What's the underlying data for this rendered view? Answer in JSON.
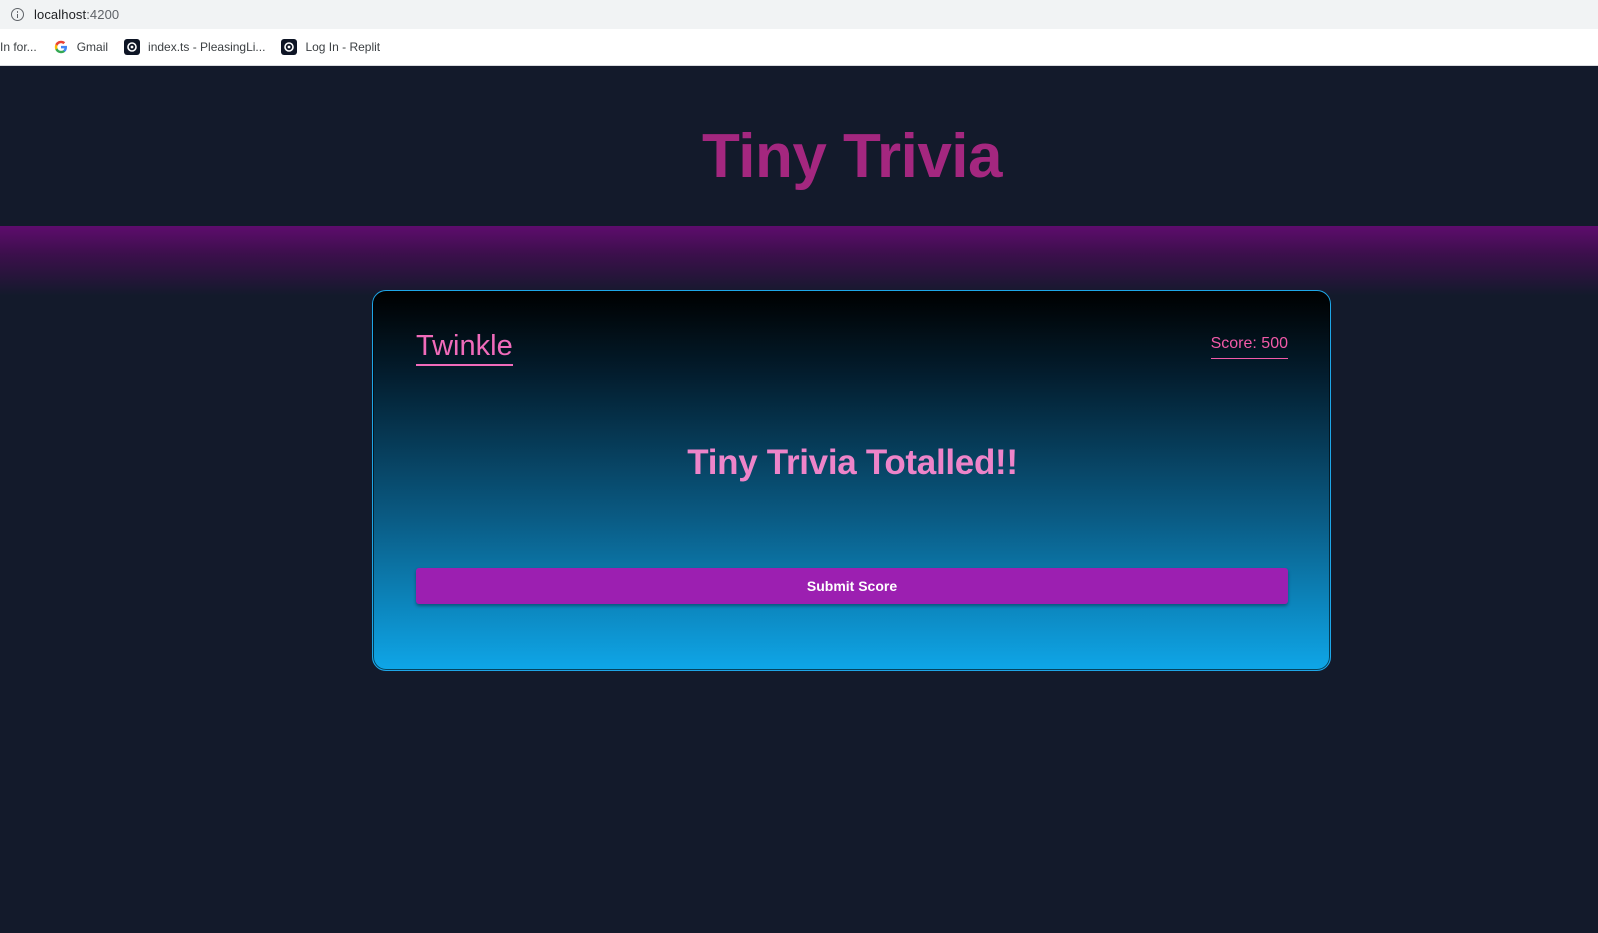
{
  "browser": {
    "url_host": "localhost",
    "url_port": ":4200",
    "bookmarks": [
      {
        "label": "In for...",
        "icon": "none"
      },
      {
        "label": "Gmail",
        "icon": "google-icon"
      },
      {
        "label": "index.ts - PleasingLi...",
        "icon": "replit-icon"
      },
      {
        "label": "Log In - Replit",
        "icon": "replit-icon"
      }
    ]
  },
  "app": {
    "title": "Tiny Trivia",
    "player_name": "Twinkle",
    "score_label": "Score: 500",
    "result_heading": "Tiny Trivia Totalled!!",
    "submit_label": "Submit Score"
  },
  "colors": {
    "background": "#131a2b",
    "title": "#a4277f",
    "band": "#5e0c6d",
    "card_border": "#1ea6e7",
    "accent_pink": "#f06bba",
    "button": "#9c1fb1"
  }
}
